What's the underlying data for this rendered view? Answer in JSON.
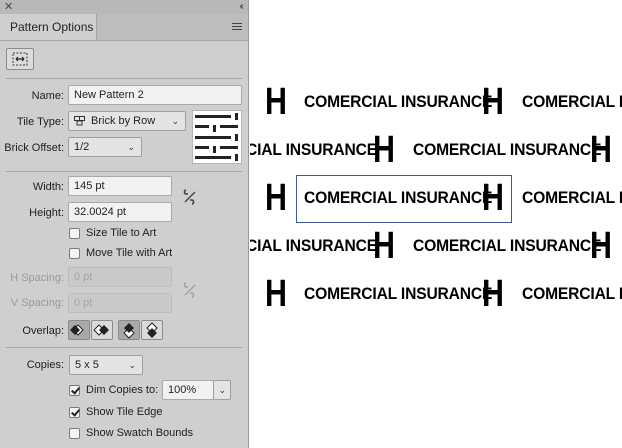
{
  "panel": {
    "tab_label": "Pattern Options",
    "name_label": "Name:",
    "name_value": "New Pattern 2",
    "tile_type_label": "Tile Type:",
    "tile_type_value": "Brick by Row",
    "brick_offset_label": "Brick Offset:",
    "brick_offset_value": "1/2",
    "width_label": "Width:",
    "width_value": "145 pt",
    "height_label": "Height:",
    "height_value": "32.0024 pt",
    "size_tile_label": "Size Tile to Art",
    "move_tile_label": "Move Tile with Art",
    "h_spacing_label": "H Spacing:",
    "h_spacing_value": "0 pt",
    "v_spacing_label": "V Spacing:",
    "v_spacing_value": "0 pt",
    "overlap_label": "Overlap:",
    "copies_label": "Copies:",
    "copies_value": "5 x 5",
    "dim_copies_label": "Dim Copies to:",
    "dim_copies_value": "100%",
    "show_tile_edge_label": "Show Tile Edge",
    "show_swatch_bounds_label": "Show Swatch Bounds",
    "checkboxes": {
      "size_tile": false,
      "move_tile": false,
      "dim_copies": true,
      "show_tile_edge": true,
      "show_swatch_bounds": false
    }
  },
  "canvas": {
    "text": "COMERCIAL INSURANCE",
    "text_left_clip": "CIAL INSURANCE",
    "text_right_clip": "COMERCIAL INS",
    "glyph": "H"
  },
  "colors": {
    "panel_bg": "#cfcfcf",
    "tile_edge": "#3f5a8f"
  }
}
